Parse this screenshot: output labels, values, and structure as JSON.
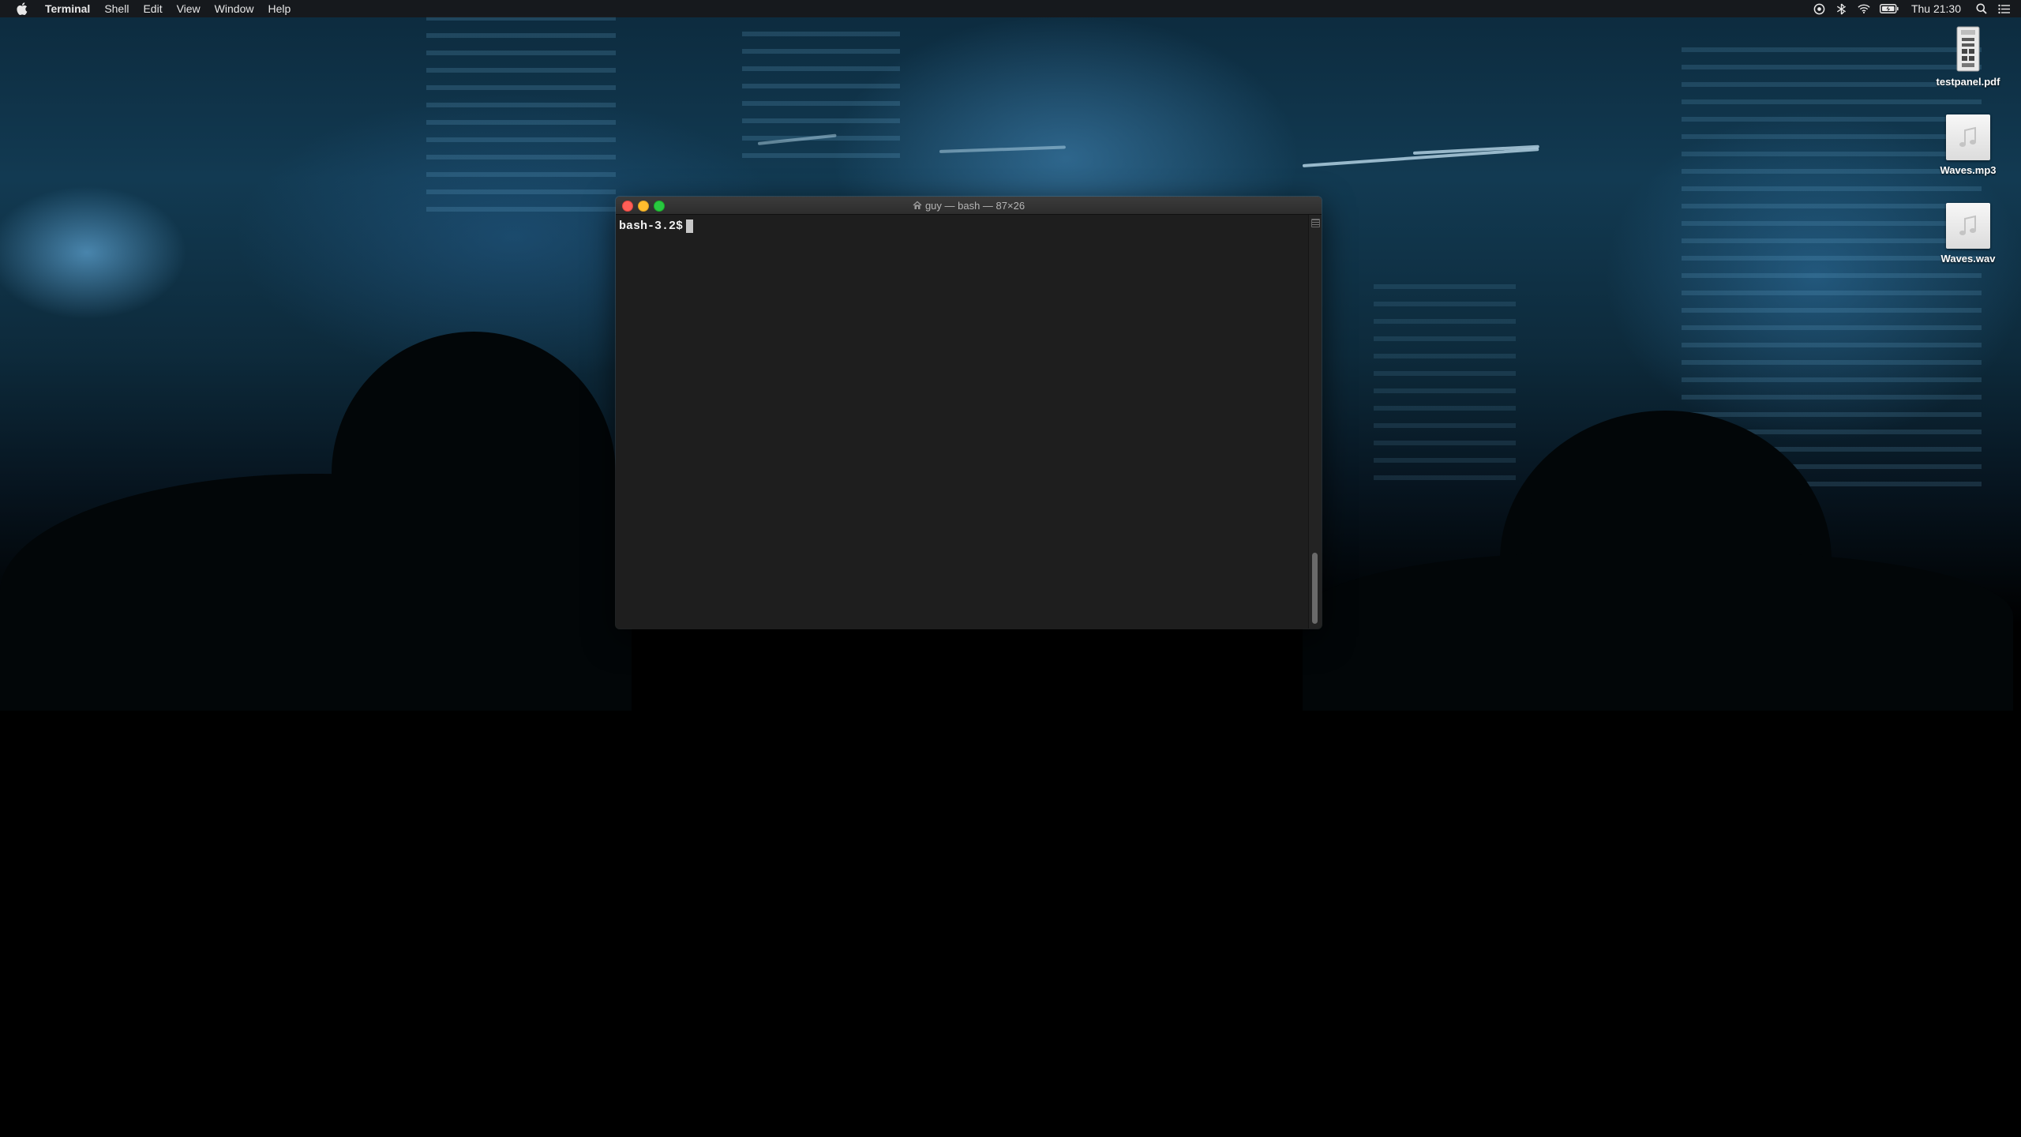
{
  "menubar": {
    "apple_icon": "apple-logo-icon",
    "app_name": "Terminal",
    "menus": [
      "Shell",
      "Edit",
      "View",
      "Window",
      "Help"
    ],
    "status_icons": [
      "vpn-icon",
      "bluetooth-icon",
      "wifi-icon",
      "battery-icon"
    ],
    "clock": "Thu 21:30",
    "search_icon": "spotlight-search-icon",
    "notifications_icon": "notification-center-icon"
  },
  "desktop": {
    "icons": [
      {
        "label": "testpanel.pdf",
        "icon": "pdf-document-icon"
      },
      {
        "label": "Waves.mp3",
        "icon": "audio-file-icon"
      },
      {
        "label": "Waves.wav",
        "icon": "audio-file-icon"
      }
    ]
  },
  "terminal": {
    "title": "guy — bash — 87×26",
    "prompt": "bash-3.2$",
    "colors": {
      "background": "#1e1e1e",
      "text": "#f0f0f0",
      "close": "#fe5f57",
      "minimize": "#febc2e",
      "zoom": "#28c840"
    }
  }
}
